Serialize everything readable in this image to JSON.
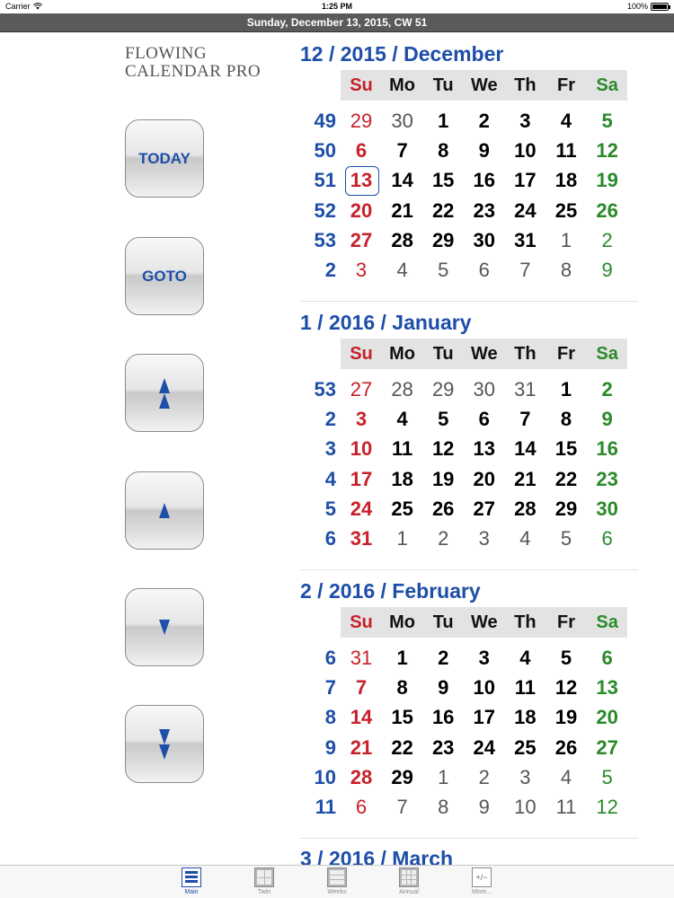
{
  "status_bar": {
    "carrier": "Carrier",
    "time": "1:25 PM",
    "battery": "100%"
  },
  "header": {
    "date_line": "Sunday, December 13, 2015, CW 51"
  },
  "app": {
    "title_line1": "FLOWING",
    "title_line2": "CALENDAR PRO"
  },
  "buttons": {
    "today": "TODAY",
    "goto": "GOTO"
  },
  "weekdays": [
    "Su",
    "Mo",
    "Tu",
    "We",
    "Th",
    "Fr",
    "Sa"
  ],
  "months": [
    {
      "title": "12 / 2015 / December",
      "weeks": [
        {
          "cw": "49",
          "days": [
            "29",
            "30",
            "1",
            "2",
            "3",
            "4",
            "5"
          ],
          "outside": [
            true,
            true,
            false,
            false,
            false,
            false,
            false
          ]
        },
        {
          "cw": "50",
          "days": [
            "6",
            "7",
            "8",
            "9",
            "10",
            "11",
            "12"
          ],
          "outside": [
            false,
            false,
            false,
            false,
            false,
            false,
            false
          ]
        },
        {
          "cw": "51",
          "days": [
            "13",
            "14",
            "15",
            "16",
            "17",
            "18",
            "19"
          ],
          "outside": [
            false,
            false,
            false,
            false,
            false,
            false,
            false
          ],
          "today_index": 0
        },
        {
          "cw": "52",
          "days": [
            "20",
            "21",
            "22",
            "23",
            "24",
            "25",
            "26"
          ],
          "outside": [
            false,
            false,
            false,
            false,
            false,
            false,
            false
          ]
        },
        {
          "cw": "53",
          "days": [
            "27",
            "28",
            "29",
            "30",
            "31",
            "1",
            "2"
          ],
          "outside": [
            false,
            false,
            false,
            false,
            false,
            true,
            true
          ]
        },
        {
          "cw": "2",
          "days": [
            "3",
            "4",
            "5",
            "6",
            "7",
            "8",
            "9"
          ],
          "outside": [
            true,
            true,
            true,
            true,
            true,
            true,
            true
          ]
        }
      ]
    },
    {
      "title": "1 / 2016 / January",
      "weeks": [
        {
          "cw": "53",
          "days": [
            "27",
            "28",
            "29",
            "30",
            "31",
            "1",
            "2"
          ],
          "outside": [
            true,
            true,
            true,
            true,
            true,
            false,
            false
          ]
        },
        {
          "cw": "2",
          "days": [
            "3",
            "4",
            "5",
            "6",
            "7",
            "8",
            "9"
          ],
          "outside": [
            false,
            false,
            false,
            false,
            false,
            false,
            false
          ]
        },
        {
          "cw": "3",
          "days": [
            "10",
            "11",
            "12",
            "13",
            "14",
            "15",
            "16"
          ],
          "outside": [
            false,
            false,
            false,
            false,
            false,
            false,
            false
          ]
        },
        {
          "cw": "4",
          "days": [
            "17",
            "18",
            "19",
            "20",
            "21",
            "22",
            "23"
          ],
          "outside": [
            false,
            false,
            false,
            false,
            false,
            false,
            false
          ]
        },
        {
          "cw": "5",
          "days": [
            "24",
            "25",
            "26",
            "27",
            "28",
            "29",
            "30"
          ],
          "outside": [
            false,
            false,
            false,
            false,
            false,
            false,
            false
          ]
        },
        {
          "cw": "6",
          "days": [
            "31",
            "1",
            "2",
            "3",
            "4",
            "5",
            "6"
          ],
          "outside": [
            false,
            true,
            true,
            true,
            true,
            true,
            true
          ]
        }
      ]
    },
    {
      "title": "2 / 2016 / February",
      "weeks": [
        {
          "cw": "6",
          "days": [
            "31",
            "1",
            "2",
            "3",
            "4",
            "5",
            "6"
          ],
          "outside": [
            true,
            false,
            false,
            false,
            false,
            false,
            false
          ]
        },
        {
          "cw": "7",
          "days": [
            "7",
            "8",
            "9",
            "10",
            "11",
            "12",
            "13"
          ],
          "outside": [
            false,
            false,
            false,
            false,
            false,
            false,
            false
          ]
        },
        {
          "cw": "8",
          "days": [
            "14",
            "15",
            "16",
            "17",
            "18",
            "19",
            "20"
          ],
          "outside": [
            false,
            false,
            false,
            false,
            false,
            false,
            false
          ]
        },
        {
          "cw": "9",
          "days": [
            "21",
            "22",
            "23",
            "24",
            "25",
            "26",
            "27"
          ],
          "outside": [
            false,
            false,
            false,
            false,
            false,
            false,
            false
          ]
        },
        {
          "cw": "10",
          "days": [
            "28",
            "29",
            "1",
            "2",
            "3",
            "4",
            "5"
          ],
          "outside": [
            false,
            false,
            true,
            true,
            true,
            true,
            true
          ]
        },
        {
          "cw": "11",
          "days": [
            "6",
            "7",
            "8",
            "9",
            "10",
            "11",
            "12"
          ],
          "outside": [
            true,
            true,
            true,
            true,
            true,
            true,
            true
          ]
        }
      ]
    }
  ],
  "next_month_title": "3 / 2016 / March",
  "tabs": [
    {
      "label": "Main",
      "active": true
    },
    {
      "label": "Twin",
      "active": false
    },
    {
      "label": "Weeks",
      "active": false
    },
    {
      "label": "Annual",
      "active": false
    },
    {
      "label": "More...",
      "active": false
    }
  ],
  "more_tab_glyph": "+/−",
  "colors": {
    "accent_blue": "#1d4ea8",
    "sunday_red": "#c8202a",
    "saturday_green": "#2a8a2a",
    "header_gray": "#5a5a5a"
  }
}
